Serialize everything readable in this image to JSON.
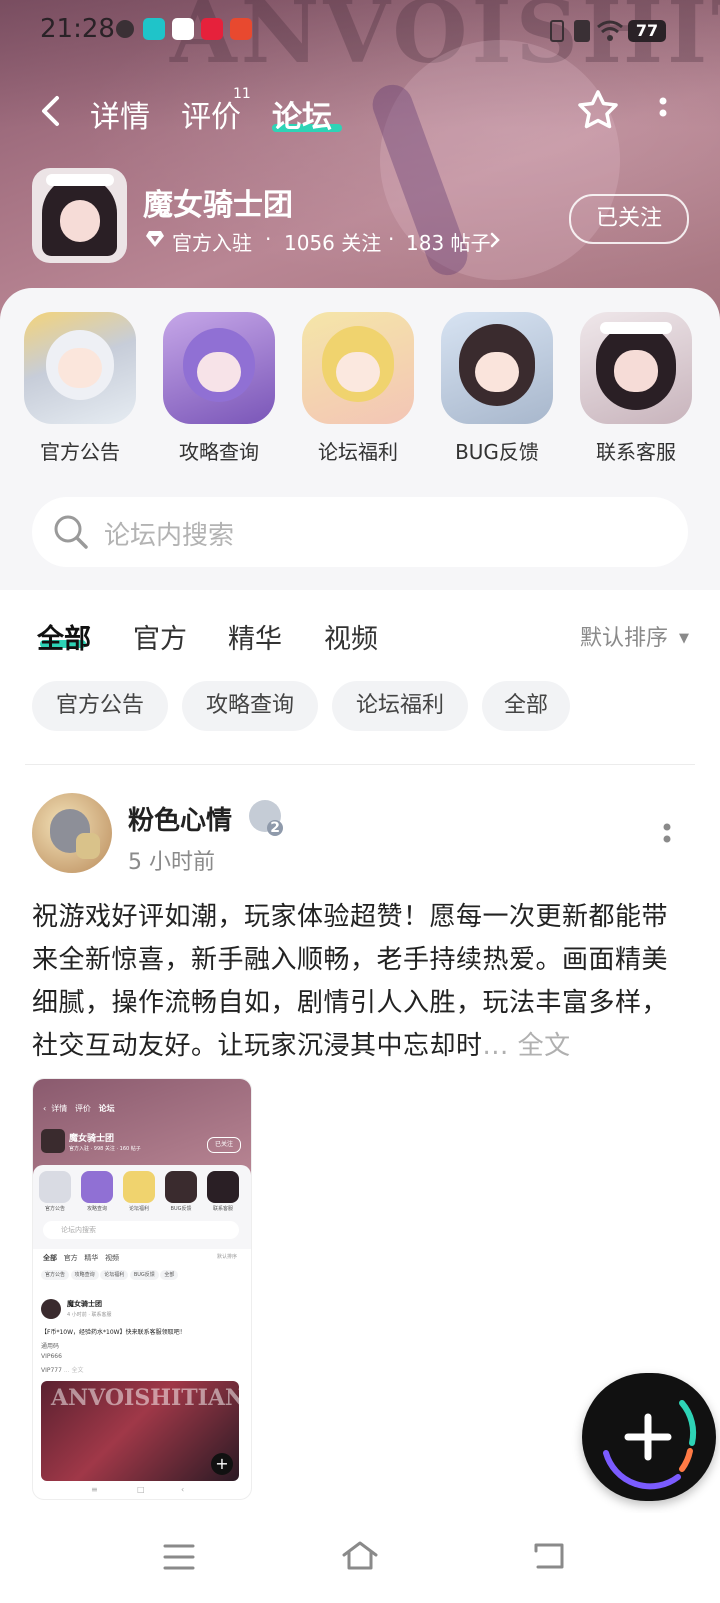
{
  "status_bar": {
    "time": "21:28",
    "battery": "77"
  },
  "header": {
    "watermark": "ANVOISHITIAN",
    "tabs": [
      {
        "label": "详情"
      },
      {
        "label": "评价",
        "badge": "11"
      },
      {
        "label": "论坛"
      }
    ],
    "forum": {
      "name": "魔女骑士团",
      "verified_label": "官方入驻",
      "followers": "1056 关注",
      "posts": "183 帖子",
      "follow_button": "已关注"
    }
  },
  "categories": [
    {
      "label": "官方公告"
    },
    {
      "label": "攻略查询"
    },
    {
      "label": "论坛福利"
    },
    {
      "label": "BUG反馈"
    },
    {
      "label": "联系客服"
    }
  ],
  "search": {
    "placeholder": "论坛内搜索"
  },
  "filter_tabs": [
    {
      "label": "全部"
    },
    {
      "label": "官方"
    },
    {
      "label": "精华"
    },
    {
      "label": "视频"
    }
  ],
  "sort_label": "默认排序",
  "chips": [
    {
      "label": "官方公告"
    },
    {
      "label": "攻略查询"
    },
    {
      "label": "论坛福利"
    },
    {
      "label": "全部"
    }
  ],
  "post": {
    "author": "粉色心情",
    "level": "2",
    "time": "5 小时前",
    "text": "祝游戏好评如潮，玩家体验超赞！愿每一次更新都能带来全新惊喜，新手融入顺畅，老手持续热爱。画面精美细腻，操作流畅自如，剧情引人入胜，玩法丰富多样，社交互动友好。让玩家沉浸其中忘却时",
    "more_label": "... 全文"
  },
  "thumbnail": {
    "nav_tabs": [
      "详情",
      "评价",
      "论坛"
    ],
    "forum_name": "魔女骑士团",
    "forum_meta": "官方入驻 · 998 关注 · 160 帖子",
    "follow": "已关注",
    "categories": [
      "官方公告",
      "攻略查询",
      "论坛福利",
      "BUG反馈",
      "联系客服"
    ],
    "search": "论坛内搜索",
    "tabs": [
      "全部",
      "官方",
      "精华",
      "视频"
    ],
    "sort": "默认排序",
    "chips": [
      "官方公告",
      "攻略查询",
      "论坛福利",
      "BUG反馈",
      "全部"
    ],
    "post_author": "魔女骑士团",
    "post_time": "4 小时前 · 联系客服",
    "post_title": "【F币*10W，经验药水*10W】快来联系客服领取吧！",
    "post_lines": [
      "通用码",
      "VIP666",
      "VIP777"
    ],
    "post_more": "... 全文",
    "banner_text": "ANVOISHITIAN"
  },
  "colors": {
    "accent": "#2ed3b6",
    "header_bg": "#a87585",
    "card_bg": "#f6f6f8",
    "chip_bg": "#f2f3f5",
    "text_primary": "#222222",
    "text_muted": "#888888"
  }
}
